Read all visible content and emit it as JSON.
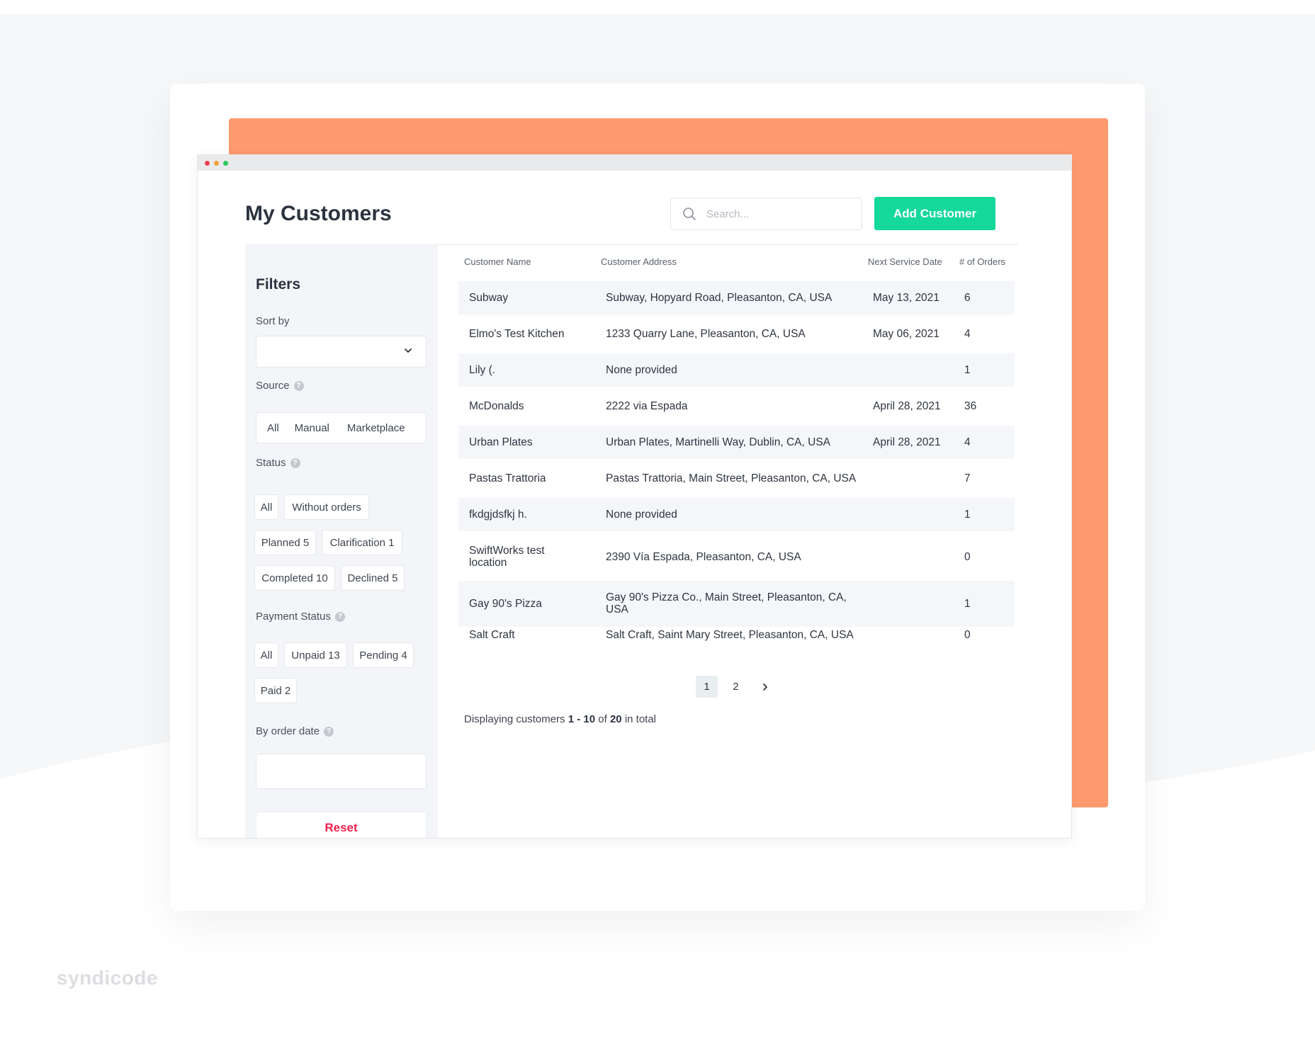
{
  "page": {
    "title": "My Customers"
  },
  "search": {
    "placeholder": "Search..."
  },
  "actions": {
    "add_customer": "Add Customer"
  },
  "filters": {
    "title": "Filters",
    "sort_by_label": "Sort by",
    "source_label": "Source",
    "source_options": [
      "All",
      "Manual",
      "Marketplace"
    ],
    "status_label": "Status",
    "status_options": [
      "All",
      "Without orders",
      "Planned 5",
      "Clarification 1",
      "Completed 10",
      "Declined 5"
    ],
    "payment_status_label": "Payment Status",
    "payment_status_options": [
      "All",
      "Unpaid 13",
      "Pending 4",
      "Paid 2"
    ],
    "order_date_label": "By order date",
    "reset_label": "Reset"
  },
  "table": {
    "columns": [
      "Customer Name",
      "Customer Address",
      "Next Service Date",
      "# of Orders"
    ],
    "rows": [
      {
        "name": "Subway",
        "address": "Subway, Hopyard Road, Pleasanton, CA, USA",
        "date": "May 13, 2021",
        "orders": "6"
      },
      {
        "name": "Elmo's Test Kitchen",
        "address": "1233 Quarry Lane, Pleasanton, CA, USA",
        "date": "May 06, 2021",
        "orders": "4"
      },
      {
        "name": "Lily (.",
        "address": "None provided",
        "date": "",
        "orders": "1"
      },
      {
        "name": "McDonalds",
        "address": "2222 via Espada",
        "date": "April 28, 2021",
        "orders": "36"
      },
      {
        "name": "Urban Plates",
        "address": "Urban Plates, Martinelli Way, Dublin, CA, USA",
        "date": "April 28, 2021",
        "orders": "4"
      },
      {
        "name": "Pastas Trattoria",
        "address": "Pastas Trattoria, Main Street, Pleasanton, CA, USA",
        "date": "",
        "orders": "7"
      },
      {
        "name": "fkdgjdsfkj h.",
        "address": "None provided",
        "date": "",
        "orders": "1"
      },
      {
        "name": "SwiftWorks test location",
        "address": "2390 Vía Espada, Pleasanton, CA, USA",
        "date": "",
        "orders": "0"
      },
      {
        "name": "Gay 90's Pizza",
        "address": "Gay 90's Pizza Co., Main Street, Pleasanton, CA, USA",
        "date": "",
        "orders": "1"
      },
      {
        "name": "Salt Craft",
        "address": "Salt Craft, Saint Mary Street, Pleasanton, CA, USA",
        "date": "",
        "orders": "0"
      }
    ]
  },
  "pagination": {
    "pages": [
      "1",
      "2"
    ],
    "current": "1",
    "next_icon": "chevron-right-icon"
  },
  "summary": {
    "prefix": "Displaying customers",
    "range": "1 - 10",
    "of": "of",
    "total": "20",
    "suffix": "in total"
  },
  "brand": {
    "name": "syndicode"
  },
  "colors": {
    "accent": "#14d99a",
    "orange": "#fe9a6e",
    "reset": "#f0214b"
  }
}
